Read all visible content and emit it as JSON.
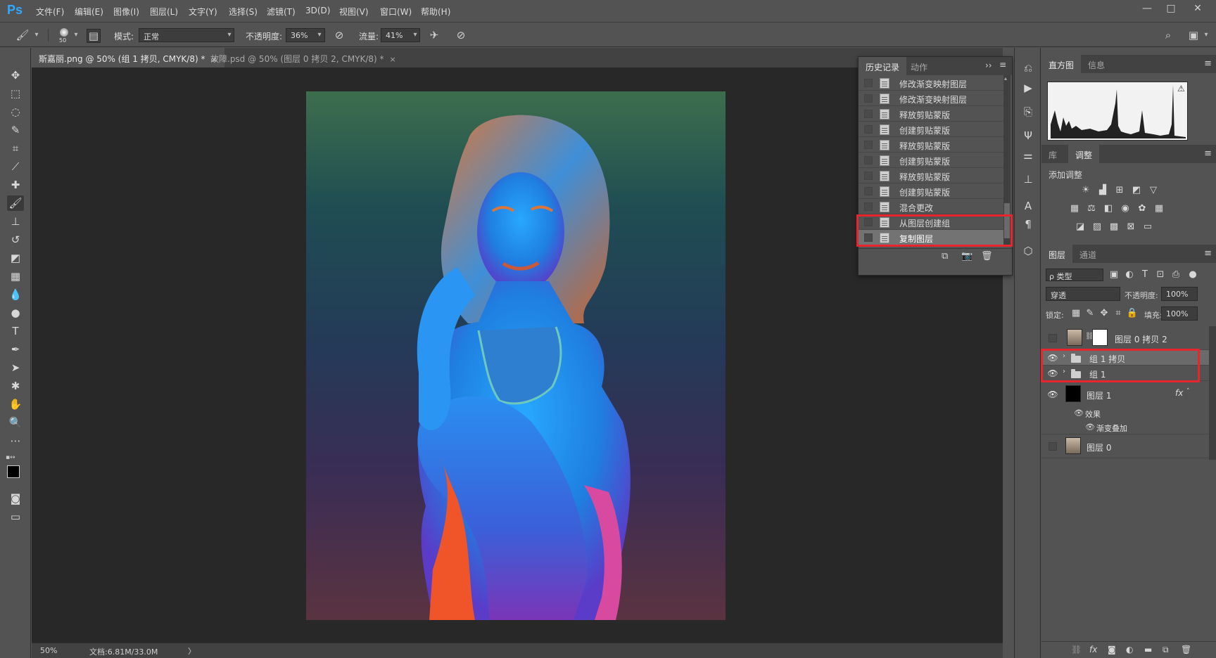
{
  "app": {
    "logo": "Ps"
  },
  "menu": {
    "items": [
      "文件(F)",
      "编辑(E)",
      "图像(I)",
      "图层(L)",
      "文字(Y)",
      "选择(S)",
      "滤镜(T)",
      "3D(D)",
      "视图(V)",
      "窗口(W)",
      "帮助(H)"
    ],
    "window_controls": [
      "—",
      "□",
      "✕"
    ]
  },
  "options": {
    "brush_size": "50",
    "mode_label": "模式:",
    "mode_value": "正常",
    "opacity_label": "不透明度:",
    "opacity_value": "36%",
    "flow_label": "流量:",
    "flow_value": "41%"
  },
  "tabs": [
    {
      "label": "斯嘉丽.png @ 50% (组 1 拷贝, CMYK/8) *",
      "close": "×"
    },
    {
      "label": "故障.psd @ 50% (图层 0 拷贝 2, CMYK/8) *",
      "close": "×"
    }
  ],
  "status": {
    "zoom": "50%",
    "doc": "文档:6.81M/33.0M",
    "arrow": "〉"
  },
  "history_panel": {
    "tabs": [
      "历史记录",
      "动作"
    ],
    "expand_glyph": "››",
    "menu_glyph": "≡",
    "items": [
      "修改渐变映射图层",
      "修改渐变映射图层",
      "释放剪贴蒙版",
      "创建剪贴蒙版",
      "释放剪贴蒙版",
      "创建剪贴蒙版",
      "释放剪贴蒙版",
      "创建剪贴蒙版",
      "混合更改",
      "从图层创建组",
      "复制图层"
    ],
    "selected_index": 10,
    "highlight_color": "#e8242d"
  },
  "histogram_panel": {
    "tabs": [
      "直方图",
      "信息"
    ],
    "warning": "⚠"
  },
  "adjust_panel": {
    "tabs": [
      "库",
      "调整"
    ],
    "title": "添加调整"
  },
  "layers_panel": {
    "tabs": [
      "图层",
      "通道"
    ],
    "filter_label": "ρ 类型",
    "blend_mode": "穿透",
    "opacity_label": "不透明度:",
    "opacity_value": "100%",
    "lock_label": "锁定:",
    "fill_label": "填充:",
    "fill_value": "100%",
    "layers": [
      {
        "name": "图层 0 拷贝 2",
        "visible": false
      },
      {
        "name": "组 1 拷贝",
        "visible": true,
        "selected": true
      },
      {
        "name": "组 1",
        "visible": true
      },
      {
        "name": "图层 1",
        "visible": true,
        "fx": "fx"
      },
      {
        "name": "效果",
        "visible": true
      },
      {
        "name": "渐变叠加",
        "visible": true
      },
      {
        "name": "图层 0",
        "visible": false
      }
    ],
    "footer_icons": [
      "link-icon",
      "fx-icon",
      "mask-icon",
      "adjustment-icon",
      "folder-icon",
      "new-layer-icon",
      "trash-icon"
    ]
  }
}
